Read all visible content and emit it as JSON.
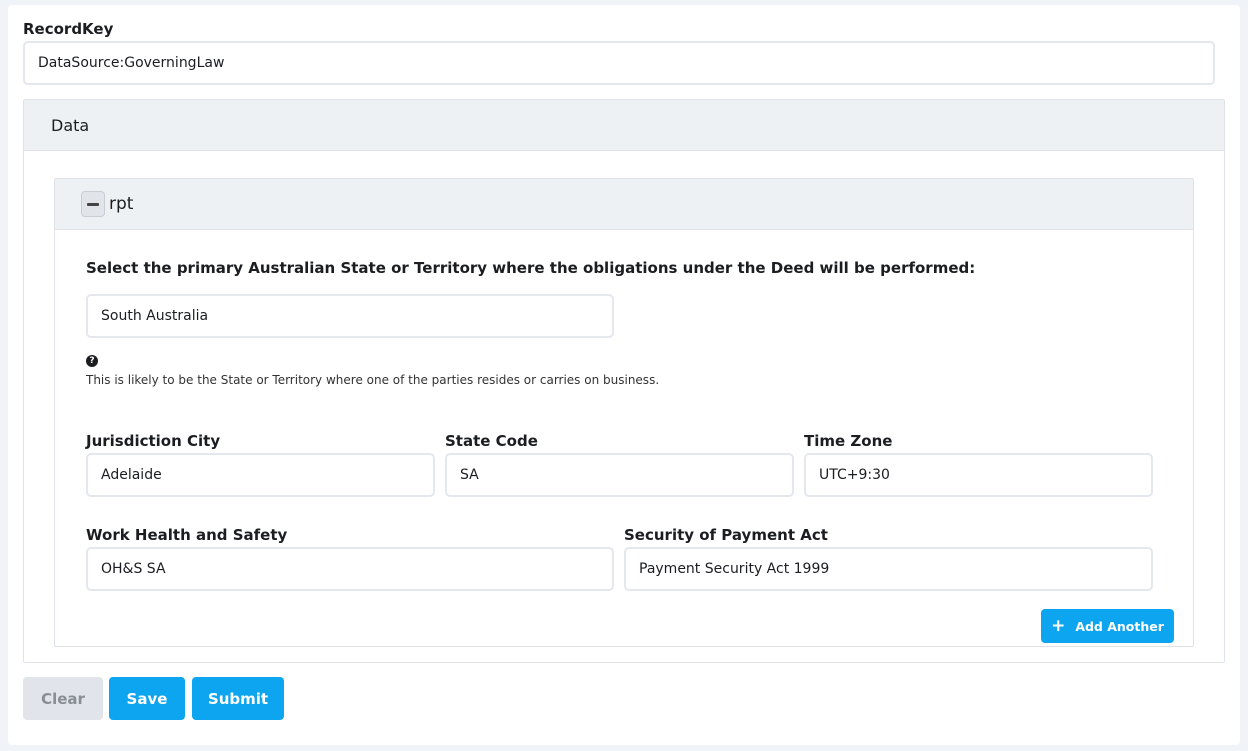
{
  "record_key": {
    "label": "RecordKey",
    "value": "DataSource:GoverningLaw"
  },
  "data_panel": {
    "title": "Data",
    "row": {
      "title": "rpt",
      "state_question": {
        "label": "Select the primary Australian State or Territory where the obligations under the Deed will be performed:",
        "value": "South Australia",
        "help_icon": "question-circle-icon",
        "help_text": "This is likely to be the State or Territory where one of the parties resides or carries on business."
      },
      "jurisdiction_city": {
        "label": "Jurisdiction City",
        "value": "Adelaide"
      },
      "state_code": {
        "label": "State Code",
        "value": "SA"
      },
      "time_zone": {
        "label": "Time Zone",
        "value": "UTC+9:30"
      },
      "work_health_safety": {
        "label": "Work Health and Safety",
        "value": "OH&S SA"
      },
      "security_of_payment": {
        "label": "Security of Payment Act",
        "value": "Payment Security Act 1999"
      }
    },
    "add_another_label": "Add Another"
  },
  "actions": {
    "clear_label": "Clear",
    "save_label": "Save",
    "submit_label": "Submit"
  },
  "colors": {
    "primary": "#0ea5f0",
    "panel_header": "#eef1f4",
    "clear_bg": "#e1e4eb"
  }
}
